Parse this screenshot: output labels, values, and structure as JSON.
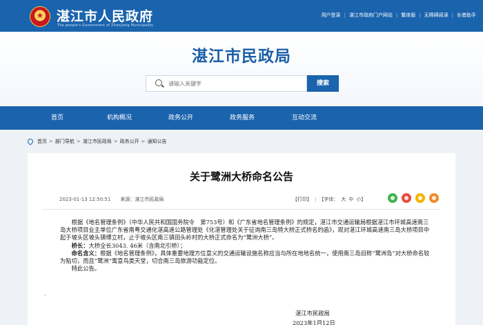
{
  "header": {
    "site_title": "湛江市人民政府",
    "site_subtitle": "The people's Government of Zhanjiang Municipality",
    "links": [
      "用户登录",
      "湛江市政府门户网站",
      "繁体版",
      "无障碍阅读",
      "长者助手"
    ]
  },
  "banner": {
    "department": "湛江市民政局",
    "search": {
      "placeholder": "请输入关键字",
      "button": "搜索"
    }
  },
  "nav": {
    "items": [
      "首页",
      "机构概况",
      "政务公开",
      "政务服务",
      "互动交流"
    ]
  },
  "breadcrumb": [
    "首页",
    "部门导航",
    "湛江市民政局",
    "政务公开",
    "通知公告"
  ],
  "article": {
    "title": "关于鹭洲大桥命名公告",
    "date": "2023-01-13 12:50:51",
    "source_label": "来源：湛江市民政局",
    "tools": {
      "print": "【打印】",
      "font_label": "【字体：",
      "sizes": [
        "大",
        "中",
        "小"
      ],
      "close": "】"
    },
    "share_icons": [
      "wechat-icon",
      "weibo-icon",
      "qzone-icon",
      "more-share-icon"
    ],
    "p1": "根据《地名管理条例》（中华人民共和国国务院令　第753号）和《广东省地名管理条例》的规定，湛江市交通运输局根据湛江市环城高速南三岛大桥项目业主单位广东省南粤交通化湛高速公路管理处《化湛管理处关于征询南三岛特大桥正式桥名的函》，现对湛江环城高速南三岛大桥项目中起于坡头区坡头镇博立村，止于坡头区南三镇田头岭村的大桥正式命名为“鹭洲大桥”。",
    "p2_label": "桥长：",
    "p2_text": "大桥全长3043. 46米（含南北引桥）；",
    "p3_label": "命名含义：",
    "p3_text": "根据《地名管理条例》，具体重要地理方位意义的交通运输设施名称应当与所在地地名统一，使用南三岛旧称“鹭洲岛”对大桥命名较为贴切，而且“鹭洲”寓意鸟类天堂，切合南三岛旅游功能定位。",
    "p4": "特此公告。",
    "dot": ".",
    "signature": "湛江市民政局",
    "sign_date": "2023年1月12日"
  }
}
